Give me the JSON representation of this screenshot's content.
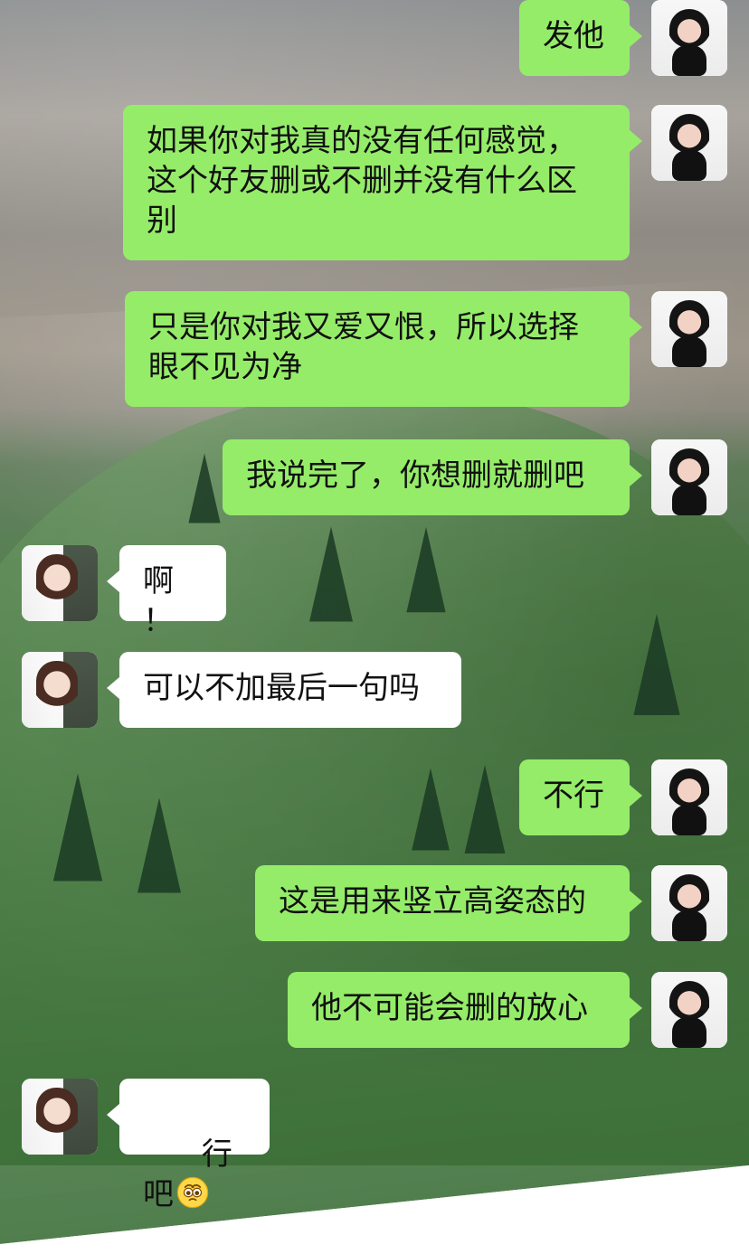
{
  "messages": [
    {
      "side": "right",
      "text": "发他"
    },
    {
      "side": "right",
      "text": "如果你对我真的没有任何感觉，\n这个好友删或不删并没有什么区\n别"
    },
    {
      "side": "right",
      "text": "只是你对我又爱又恨，所以选择\n眼不见为净"
    },
    {
      "side": "right",
      "text": "我说完了，你想删就删吧"
    },
    {
      "side": "left",
      "text": "啊！"
    },
    {
      "side": "left",
      "text": "可以不加最后一句吗"
    },
    {
      "side": "right",
      "text": "不行"
    },
    {
      "side": "right",
      "text": "这是用来竖立高姿态的"
    },
    {
      "side": "right",
      "text": "他不可能会删的放心"
    },
    {
      "side": "left",
      "text": "行吧",
      "emoji": "pleading-face"
    }
  ],
  "colors": {
    "self_bubble": "#95ec69",
    "other_bubble": "#ffffff"
  }
}
